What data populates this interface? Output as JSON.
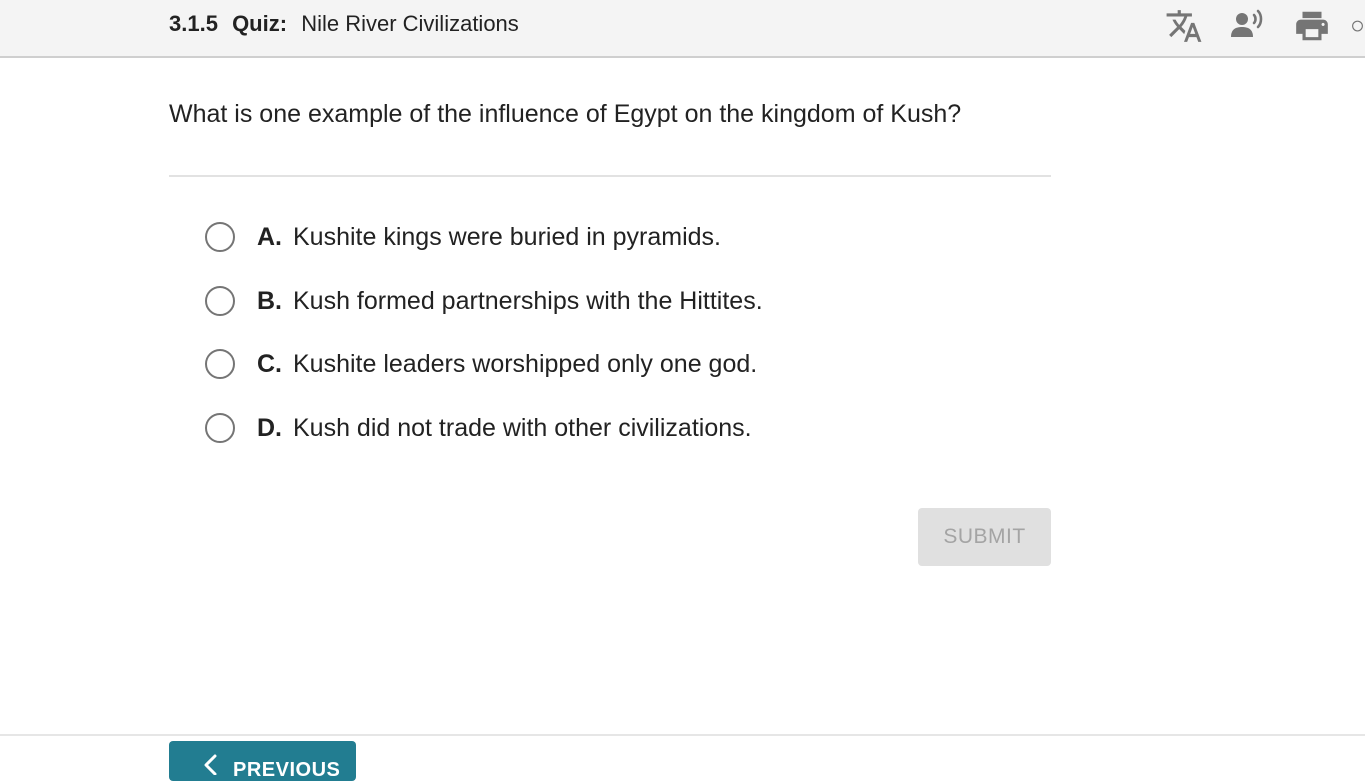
{
  "header": {
    "quiz_number": "3.1.5",
    "quiz_type": "Quiz:",
    "quiz_title": "Nile River Civilizations",
    "icons": [
      "translate-icon",
      "read-aloud-icon",
      "print-icon",
      "more-icon"
    ]
  },
  "question": {
    "text": "What is one example of the influence of Egypt on the kingdom of Kush?",
    "options": [
      {
        "letter": "A.",
        "text": "Kushite kings were buried in pyramids."
      },
      {
        "letter": "B.",
        "text": "Kush formed partnerships with the Hittites."
      },
      {
        "letter": "C.",
        "text": "Kushite leaders worshipped only one god."
      },
      {
        "letter": "D.",
        "text": "Kush did not trade with other civilizations."
      }
    ]
  },
  "actions": {
    "submit_label": "SUBMIT",
    "previous_label": "PREVIOUS"
  },
  "colors": {
    "accent": "#227d91",
    "submit_disabled_bg": "#e0e0e0",
    "icon": "#757575"
  }
}
